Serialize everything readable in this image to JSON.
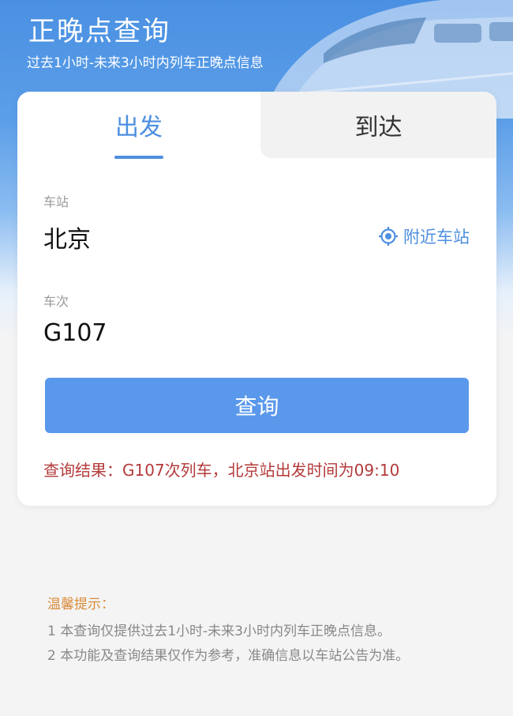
{
  "header": {
    "title": "正晚点查询",
    "subtitle": "过去1小时-未来3小时内列车正晚点信息"
  },
  "tabs": [
    {
      "label": "出发",
      "active": true
    },
    {
      "label": "到达",
      "active": false
    }
  ],
  "form": {
    "station_label": "车站",
    "station_value": "北京",
    "nearby_label": "附近车站",
    "nearby_icon": "location-target-icon",
    "train_label": "车次",
    "train_value": "G107"
  },
  "query_button": "查询",
  "result_text": "查询结果：G107次列车，北京站出发时间为09:10",
  "tips": {
    "title": "温馨提示：",
    "items": [
      "1 本查询仅提供过去1小时-未来3小时内列车正晚点信息。",
      "2 本功能及查询结果仅作为参考，准确信息以车站公告为准。"
    ]
  },
  "colors": {
    "accent": "#4d8fe0",
    "button": "#5a98ec",
    "result": "#b43a3a",
    "tips_title": "#d98b3a"
  }
}
